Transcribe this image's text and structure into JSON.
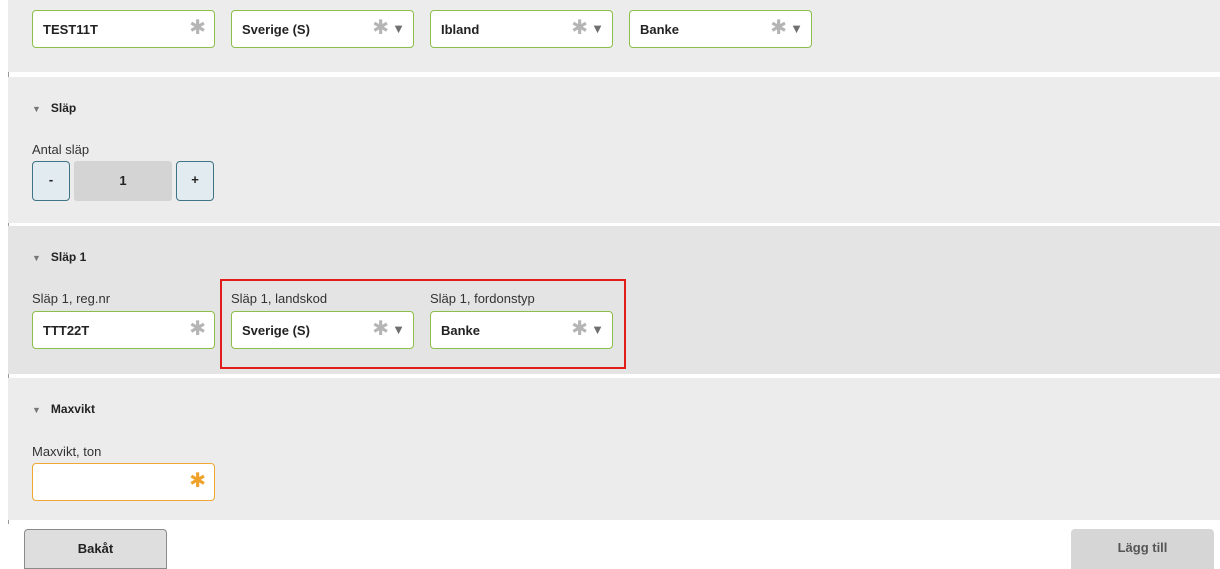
{
  "top_row": {
    "reg": {
      "value": "TEST11T"
    },
    "country": {
      "value": "Sverige (S)"
    },
    "frequency": {
      "value": "Ibland"
    },
    "vehicle_type": {
      "value": "Banke"
    }
  },
  "slap": {
    "heading": "Släp",
    "count_label": "Antal släp",
    "minus_label": "-",
    "count_value": "1",
    "plus_label": "+"
  },
  "slap1": {
    "heading": "Släp 1",
    "reg_label": "Släp 1, reg.nr",
    "reg_value": "TTT22T",
    "country_label": "Släp 1, landskod",
    "country_value": "Sverige (S)",
    "type_label": "Släp 1, fordonstyp",
    "type_value": "Banke"
  },
  "maxvikt": {
    "heading": "Maxvikt",
    "label": "Maxvikt, ton",
    "value": ""
  },
  "footer": {
    "back_label": "Bakåt",
    "add_label": "Lägg till"
  },
  "icons": {
    "required": "asterisk-icon",
    "dropdown": "triangle-down-icon",
    "collapse": "triangle-down-icon"
  },
  "colors": {
    "field_border_valid": "#8bbf4a",
    "field_border_required": "#f0a834",
    "highlight_box": "#e21b1b",
    "stepper_border": "#3f7486"
  }
}
